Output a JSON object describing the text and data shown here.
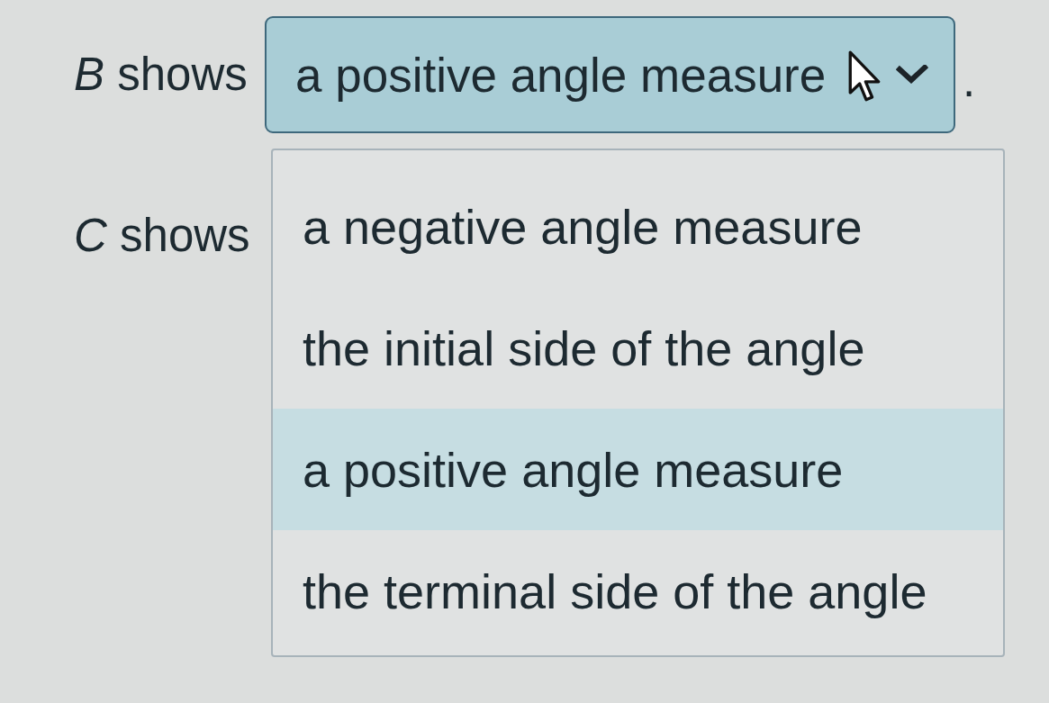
{
  "items": [
    {
      "prompt": "*B* shows",
      "select": {
        "value": "a positive angle measure",
        "expanded": true,
        "options": [
          {
            "label": "a negative angle measure",
            "selected": false
          },
          {
            "label": "the initial side of the angle",
            "selected": false
          },
          {
            "label": "a positive angle measure",
            "selected": true
          },
          {
            "label": "the terminal side of the angle",
            "selected": false
          }
        ]
      },
      "after": "."
    },
    {
      "prompt": "*C* shows"
    }
  ]
}
